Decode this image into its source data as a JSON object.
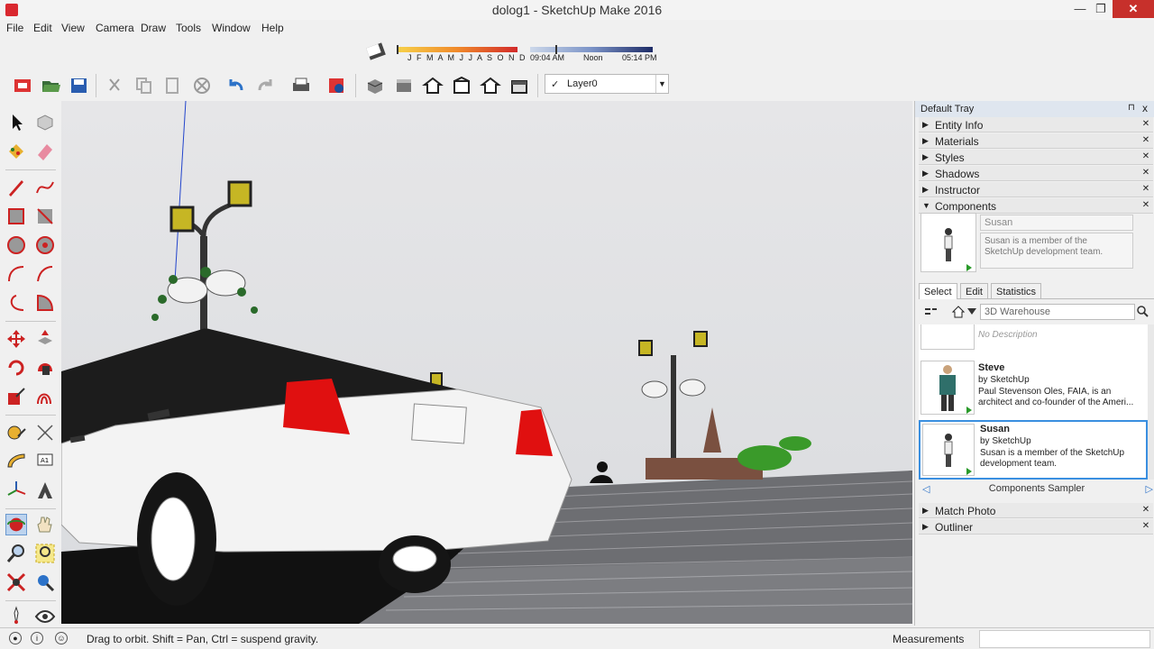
{
  "window": {
    "title": "dolog1 - SketchUp Make 2016",
    "minimize": "—",
    "maximize": "❐",
    "close": "✕"
  },
  "menu": [
    "File",
    "Edit",
    "View",
    "Camera",
    "Draw",
    "Tools",
    "Window",
    "Help"
  ],
  "shadow_toolbar": {
    "months": "J F M A M J J A S O N D",
    "time_start": "09:04 AM",
    "time_mid": "Noon",
    "time_end": "05:14 PM"
  },
  "layer": {
    "checkmark": "✓",
    "value": "Layer0",
    "arrow": "▼"
  },
  "tray": {
    "title": "Default Tray",
    "pin": "⊓",
    "close": "x",
    "panels_top": [
      {
        "label": "Entity Info",
        "expanded": false
      },
      {
        "label": "Materials",
        "expanded": false
      },
      {
        "label": "Styles",
        "expanded": false
      },
      {
        "label": "Shadows",
        "expanded": false
      },
      {
        "label": "Instructor",
        "expanded": false
      },
      {
        "label": "Components",
        "expanded": true
      }
    ],
    "panels_bottom": [
      {
        "label": "Match Photo"
      },
      {
        "label": "Outliner"
      }
    ],
    "collapsed_glyph": "▶",
    "expanded_glyph": "▼",
    "close_glyph": "✕"
  },
  "components": {
    "selected_name": "Susan",
    "selected_desc": "Susan is a member of the SketchUp development team.",
    "tabs": [
      "Select",
      "Edit",
      "Statistics"
    ],
    "active_tab": "Select",
    "search_value": "3D Warehouse",
    "list": [
      {
        "name": "",
        "by": "",
        "desc": "No Description"
      },
      {
        "name": "Steve",
        "by": "by SketchUp",
        "desc": "Paul Stevenson Oles, FAIA, is an architect and co-founder of the Ameri..."
      },
      {
        "name": "Susan",
        "by": "by SketchUp",
        "desc": "Susan is a member of the SketchUp development team.",
        "selected": true
      }
    ],
    "collection": "Components Sampler"
  },
  "status": {
    "message": "Drag to orbit. Shift = Pan, Ctrl = suspend gravity.",
    "measurements_label": "Measurements",
    "measurements_value": ""
  },
  "colors": {
    "accent": "#3a8fe0",
    "close_red": "#c7302b",
    "taillight": "#e01010"
  }
}
